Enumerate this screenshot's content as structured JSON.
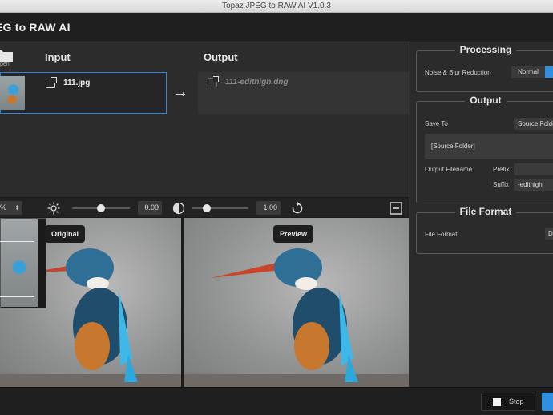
{
  "window": {
    "title": "Topaz JPEG to RAW AI V1.0.3"
  },
  "app": {
    "title": "EG to RAW AI"
  },
  "io": {
    "open_label": "pen",
    "input_header": "Input",
    "output_header": "Output",
    "input_file": "111.jpg",
    "output_file": "111-edithigh.dng",
    "arrow": "→"
  },
  "toolbar": {
    "zoom": "%",
    "brightness_value": "0.00",
    "brightness_level": 0.5,
    "contrast_value": "1.00",
    "contrast_level": 0.25
  },
  "viewer": {
    "original_label": "Original",
    "preview_label": "Preview"
  },
  "processing": {
    "title": "Processing",
    "noise_label": "Noise & Blur Reduction",
    "noise_option": "Normal",
    "accent": "#2f8fe0"
  },
  "output": {
    "title": "Output",
    "save_to_label": "Save To",
    "save_to_value": "Source Folder",
    "folder_display": "[Source Folder]",
    "filename_label": "Output Filename",
    "prefix_label": "Prefix",
    "prefix_value": "",
    "suffix_label": "Suffix",
    "suffix_value": "-edithigh"
  },
  "file_format": {
    "title": "File Format",
    "label": "File Format",
    "value": "D"
  },
  "actions": {
    "stop_label": "Stop"
  }
}
